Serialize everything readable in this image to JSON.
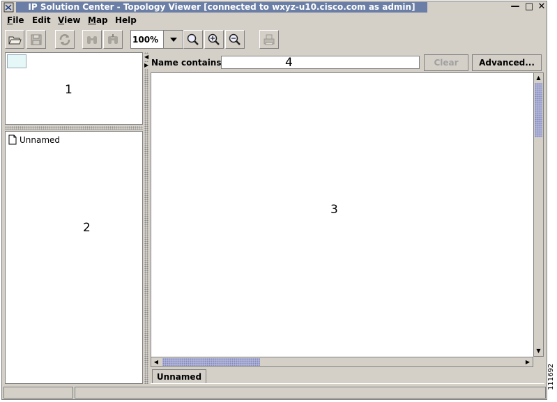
{
  "window": {
    "title": "IP Solution Center - Topology Viewer [connected to wxyz-u10.cisco.com as admin]",
    "controls": {
      "minimize": "—",
      "maximize": "□",
      "close": "✕"
    }
  },
  "menubar": {
    "items": [
      {
        "label": "File",
        "mnemonic": "F",
        "rest": "ile"
      },
      {
        "label": "Edit",
        "mnemonic": "",
        "rest": "Edit"
      },
      {
        "label": "View",
        "mnemonic": "V",
        "rest": "iew"
      },
      {
        "label": "Map",
        "mnemonic": "M",
        "rest": "ap"
      },
      {
        "label": "Help",
        "mnemonic": "",
        "rest": "Help"
      }
    ]
  },
  "toolbar": {
    "icons": [
      "open-folder-icon",
      "save-disk-icon",
      "refresh-icon",
      "find-binoculars-icon",
      "find-next-binoculars-icon",
      "zoom-icon",
      "zoom-in-icon",
      "zoom-out-icon",
      "print-icon"
    ],
    "zoom_value": "100%"
  },
  "overview_pane": {
    "callout": "1"
  },
  "tree_pane": {
    "item_label": "Unnamed",
    "item_icon": "document-icon",
    "callout": "2"
  },
  "filter": {
    "label": "Name contains:",
    "value": "",
    "placeholder": "",
    "callout": "4",
    "clear_label": "Clear",
    "advanced_label": "Advanced..."
  },
  "canvas": {
    "callout": "3"
  },
  "tabs": [
    {
      "label": "Unnamed"
    }
  ],
  "figure_number": "111692",
  "colors": {
    "chrome": "#d4d0c8",
    "title_strip": "#6b7fa6",
    "scroll_thumb": "#b0b4d8"
  }
}
